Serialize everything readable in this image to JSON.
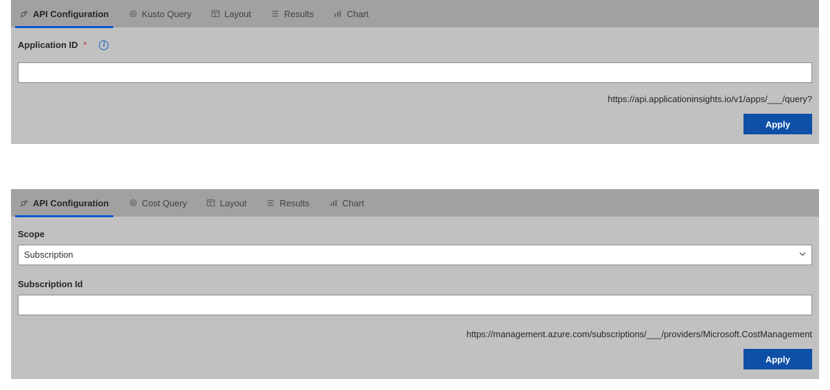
{
  "panel1": {
    "tabs": {
      "api_config": "API Configuration",
      "kusto": "Kusto Query",
      "layout": "Layout",
      "results": "Results",
      "chart": "Chart"
    },
    "field_label": "Application ID",
    "field_value": "",
    "helper_text": "https://api.applicationinsights.io/v1/apps/___/query?",
    "apply_label": "Apply"
  },
  "panel2": {
    "tabs": {
      "api_config": "API Configuration",
      "cost": "Cost Query",
      "layout": "Layout",
      "results": "Results",
      "chart": "Chart"
    },
    "scope_label": "Scope",
    "scope_value": "Subscription",
    "subid_label": "Subscription Id",
    "subid_value": "",
    "helper_text": "https://management.azure.com/subscriptions/___/providers/Microsoft.CostManagement",
    "apply_label": "Apply"
  }
}
